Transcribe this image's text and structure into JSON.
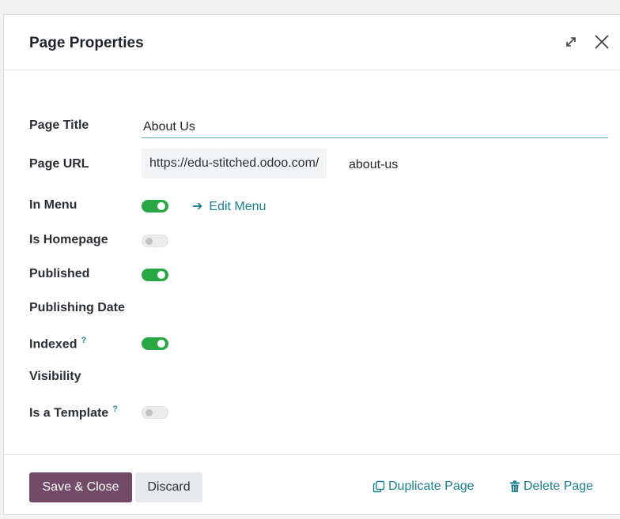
{
  "dialog": {
    "title": "Page Properties",
    "expand_icon": "expand-arrows-icon",
    "close_icon": "close-icon"
  },
  "fields": {
    "page_title": {
      "label": "Page Title",
      "value": "About Us"
    },
    "page_url": {
      "label": "Page URL",
      "prefix": "https://edu-stitched.odoo.com/",
      "value": "about-us"
    },
    "in_menu": {
      "label": "In Menu",
      "on": true,
      "edit_link": "Edit Menu"
    },
    "is_homepage": {
      "label": "Is Homepage",
      "on": false
    },
    "published": {
      "label": "Published",
      "on": true
    },
    "publishing_date": {
      "label": "Publishing Date"
    },
    "indexed": {
      "label": "Indexed",
      "help": "?",
      "on": true
    },
    "visibility": {
      "label": "Visibility"
    },
    "is_template": {
      "label": "Is a Template",
      "help": "?",
      "on": false
    }
  },
  "footer": {
    "save_label": "Save & Close",
    "discard_label": "Discard",
    "duplicate_label": "Duplicate Page",
    "delete_label": "Delete Page"
  },
  "colors": {
    "primary": "#714b67",
    "toggle_on": "#28a745",
    "link": "#1a7f8e"
  }
}
